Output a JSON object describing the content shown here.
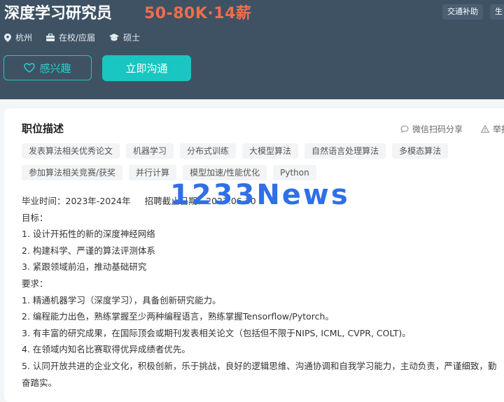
{
  "job": {
    "title": "深度学习研究员",
    "salary": "50-80K·14薪",
    "benefits": [
      "交通补助",
      "生"
    ]
  },
  "info": {
    "location": "杭州",
    "status": "在校/应届",
    "degree": "硕士"
  },
  "actions": {
    "interest_label": "感兴趣",
    "chat_label": "立即沟通"
  },
  "section": {
    "title": "职位描述",
    "share_label": "微信扫码分享",
    "report_label": "举报"
  },
  "tags": [
    "发表算法相关优秀论文",
    "机器学习",
    "分布式训练",
    "大模型算法",
    "自然语言处理算法",
    "多模态算法",
    "参加算法相关竞赛/获奖",
    "并行计算",
    "模型加速/性能优化",
    "Python"
  ],
  "description": {
    "grad_time": "毕业时间：2023年-2024年",
    "deadline": "招聘截止日期：2023.06.30",
    "lines": [
      "目标：",
      "1. 设计开拓性的新的深度神经网络",
      "2. 构建科学、严谨的算法评测体系",
      "3. 紧跟领域前沿，推动基础研究",
      "要求：",
      "1. 精通机器学习（深度学习），具备创新研究能力。",
      "2. 编程能力出色，熟练掌握至少两种编程语言，熟练掌握Tensorflow/Pytorch。",
      "3. 有丰富的研究成果，在国际顶会或期刊发表相关论文（包括但不限于NIPS, ICML, CVPR, COLT)。",
      "4. 在领域内知名比赛取得优异成绩者优先。",
      "5. 认同开放共进的企业文化，积极创新，乐于挑战，良好的逻辑思维、沟通协调和自我学习能力，主动负责，严谨细致，勤",
      "奋踏实。"
    ]
  },
  "watermark": "1233News",
  "colors": {
    "header_bg": "#3e5264",
    "salary": "#f26d4a",
    "accent": "#19c6c1",
    "watermark": "#2f6fe8"
  }
}
